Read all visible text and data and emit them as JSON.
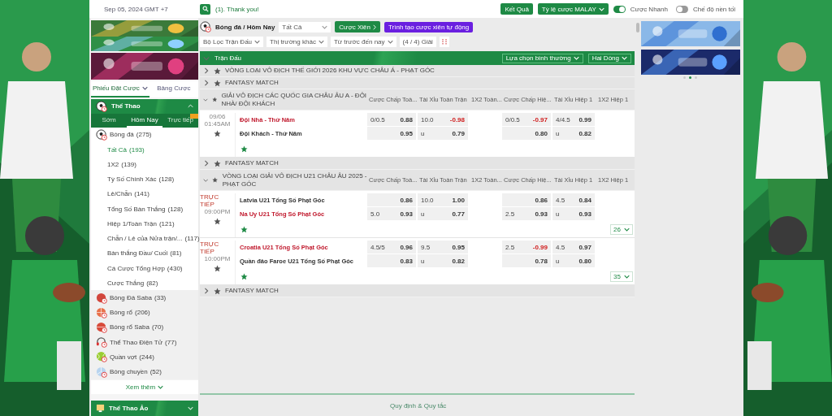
{
  "top_bar": {
    "datetime": "Sep 05, 2024 GMT +7",
    "announcement": "(1). Thank you!",
    "results_button": "Kết Quả",
    "odds_type": "Tỷ lệ cược MALAY",
    "toggles": [
      {
        "label": "Cược Nhanh",
        "on": true
      },
      {
        "label": "Chế độ nền tối",
        "on": false
      }
    ]
  },
  "sidebar": {
    "tabs": [
      {
        "label": "Phiếu Đặt Cược",
        "selected": true
      },
      {
        "label": "Bảng Cược",
        "selected": false
      }
    ],
    "sports_header": "Thể Thao",
    "period_tabs": [
      {
        "label": "Sớm",
        "selected": false
      },
      {
        "label": "Hôm Nay",
        "selected": true
      },
      {
        "label": "Trực tiếp",
        "selected": false
      }
    ],
    "sports": [
      {
        "kind": "soccer",
        "name": "Bóng đá",
        "count": "(275)",
        "expanded": true,
        "children": [
          {
            "label": "Tất Cả",
            "count": "(193)",
            "selected": true
          },
          {
            "label": "1X2",
            "count": "(139)",
            "selected": false
          },
          {
            "label": "Tỷ Số Chính Xác",
            "count": "(128)",
            "selected": false
          },
          {
            "label": "Lẻ/Chẵn",
            "count": "(141)",
            "selected": false
          },
          {
            "label": "Tổng Số Bàn Thắng",
            "count": "(128)",
            "selected": false
          },
          {
            "label": "Hiệp 1/Toàn Trận",
            "count": "(121)",
            "selected": false
          },
          {
            "label": "Chẵn / Lẻ của Nửa trận/...",
            "count": "(117)",
            "selected": false
          },
          {
            "label": "Bàn thắng Đầu/ Cuối",
            "count": "(81)",
            "selected": false
          },
          {
            "label": "Cá Cược Tổng Hợp",
            "count": "(430)",
            "selected": false
          },
          {
            "label": "Cược Thắng",
            "count": "(82)",
            "selected": false
          }
        ]
      },
      {
        "kind": "soccer-saba",
        "name": "Bóng Đá Saba",
        "count": "(33)",
        "expanded": false
      },
      {
        "kind": "basketball",
        "name": "Bóng rổ",
        "count": "(206)",
        "expanded": false
      },
      {
        "kind": "basketball-saba",
        "name": "Bóng rổ Saba",
        "count": "(70)",
        "expanded": false
      },
      {
        "kind": "esports",
        "name": "Thể Thao Điện Tử",
        "count": "(77)",
        "expanded": false
      },
      {
        "kind": "tennis",
        "name": "Quần vợt",
        "count": "(244)",
        "expanded": false
      },
      {
        "kind": "volleyball",
        "name": "Bóng chuyền",
        "count": "(52)",
        "expanded": false
      }
    ],
    "more": "Xem thêm",
    "virtual_header": "Thể Thao Ảo"
  },
  "main": {
    "breadcrumb": "Bóng đá / Hôm Nay",
    "market_select": "Tất Cả",
    "parlay_button": "Cược Xiên",
    "auto_parlay_button": "Trình tạo cược xiên tự động",
    "filters": [
      "Bộ Lọc Trận Đấu",
      "Thị trường khác",
      "Từ trước đến nay"
    ],
    "league_count": "(4 / 4) Giải",
    "table_title": "Trận Đấu",
    "view_options": [
      "Lựa chọn bình thường",
      "Hai Dòng"
    ],
    "leagues": [
      {
        "name": "VÒNG LOẠI VÔ ĐỊCH THẾ GIỚI 2026 KHU VỰC CHÂU Á - PHẠT GÓC",
        "expanded": false
      },
      {
        "name": "FANTASY MATCH",
        "expanded": false
      },
      {
        "name": "GIẢI VÔ ĐỊCH CÁC QUỐC GIA CHÂU ÂU A - ĐỘI NHÀ/ ĐỘI KHÁCH",
        "expanded": true,
        "columns": [
          "Cược Chấp Toà...",
          "Tài Xỉu Toàn Trận",
          "1X2 Toàn...",
          "Cược Chấp Hiệ...",
          "Tài Xỉu Hiệp 1",
          "1X2 Hiệp 1"
        ],
        "matches": [
          {
            "status": "09/06",
            "time": "01:45AM",
            "live": false,
            "teams": [
              {
                "name": "Đội Nhà - Thứ Năm",
                "favored": true,
                "odds": [
                  {
                    "line": "0/0.5",
                    "price": "0.88"
                  },
                  {
                    "line": "10.0",
                    "price": "-0.98"
                  },
                  {
                    "line": "0/0.5",
                    "price": "-0.97"
                  },
                  {
                    "line": "4/4.5",
                    "price": "0.99"
                  }
                ]
              },
              {
                "name": "Đội Khách - Thứ Năm",
                "favored": false,
                "odds": [
                  {
                    "price": "0.95"
                  },
                  {
                    "line": "u",
                    "price": "0.79"
                  },
                  {
                    "price": "0.80"
                  },
                  {
                    "line": "u",
                    "price": "0.82"
                  }
                ]
              }
            ]
          }
        ]
      },
      {
        "name": "FANTASY MATCH",
        "expanded": false
      },
      {
        "name": "VÒNG LOẠI GIẢI VÔ ĐỊCH U21 CHÂU ÂU 2025 - PHẠT GÓC",
        "expanded": true,
        "columns": [
          "Cược Chấp Toà...",
          "Tài Xỉu Toàn Trận",
          "1X2 Toàn...",
          "Cược Chấp Hiệ...",
          "Tài Xỉu Hiệp 1",
          "1X2 Hiệp 1"
        ],
        "matches": [
          {
            "status": "TRỰC TIẾP",
            "time": "09:00PM",
            "live": true,
            "more_count": "26",
            "teams": [
              {
                "name": "Latvia U21 Tổng Số Phạt Góc",
                "favored": false,
                "odds": [
                  {
                    "price": "0.86"
                  },
                  {
                    "line": "10.0",
                    "price": "1.00"
                  },
                  {
                    "price": "0.86"
                  },
                  {
                    "line": "4.5",
                    "price": "0.84"
                  }
                ]
              },
              {
                "name": "Na Uy U21 Tổng Số Phạt Góc",
                "favored": true,
                "odds": [
                  {
                    "line": "5.0",
                    "price": "0.93"
                  },
                  {
                    "line": "u",
                    "price": "0.77"
                  },
                  {
                    "line": "2.5",
                    "price": "0.93"
                  },
                  {
                    "line": "u",
                    "price": "0.93"
                  }
                ]
              }
            ]
          },
          {
            "status": "TRỰC TIẾP",
            "time": "10:00PM",
            "live": true,
            "more_count": "35",
            "teams": [
              {
                "name": "Croatia U21 Tổng Số Phạt Góc",
                "favored": true,
                "odds": [
                  {
                    "line": "4.5/5",
                    "price": "0.96"
                  },
                  {
                    "line": "9.5",
                    "price": "0.95"
                  },
                  {
                    "line": "2.5",
                    "price": "-0.99"
                  },
                  {
                    "line": "4.5",
                    "price": "0.97"
                  }
                ]
              },
              {
                "name": "Quần đảo Faroe U21 Tổng Số Phạt Góc",
                "favored": false,
                "odds": [
                  {
                    "price": "0.83"
                  },
                  {
                    "line": "u",
                    "price": "0.82"
                  },
                  {
                    "price": "0.78"
                  },
                  {
                    "line": "u",
                    "price": "0.80"
                  }
                ]
              }
            ]
          }
        ]
      },
      {
        "name": "FANTASY MATCH",
        "expanded": false
      }
    ],
    "footer_link": "Quy định & Quy tắc"
  }
}
